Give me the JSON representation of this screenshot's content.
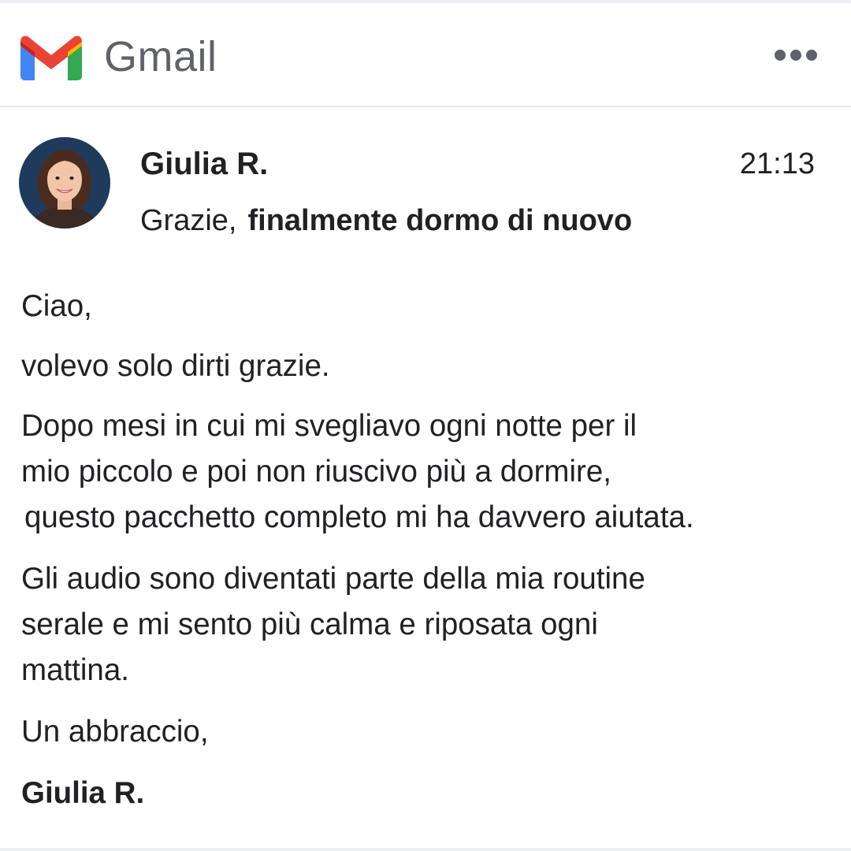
{
  "header": {
    "app_title": "Gmail",
    "logo_icon": "gmail-logo-icon",
    "more_icon": "more-horizontal-icon"
  },
  "message": {
    "sender_name": "Giulia R.",
    "time": "21:13",
    "subject_lead": "Grazie,",
    "subject_rest": "finalmente dormo di nuovo",
    "avatar_icon": "sender-avatar"
  },
  "body": {
    "greeting": "Ciao,",
    "thanks": "volevo solo dirti grazie.",
    "story_line1": "Dopo mesi in cui mi svegliavo ogni notte per il",
    "story_line2": "mio piccolo e poi non riuscivo più a dormire,",
    "story_line3": "questo pacchetto completo mi ha davvero aiutata.",
    "audio_line1": "Gli audio sono diventati parte della mia routine",
    "audio_line2": "serale e mi sento più calma e riposata ogni",
    "audio_line3": "mattina.",
    "closing": "Un abbraccio,",
    "signature": "Giulia R."
  },
  "colors": {
    "gmail_red": "#EA4335",
    "gmail_blue": "#4285F4",
    "gmail_green": "#34A853",
    "gmail_yellow": "#FBBC04",
    "title_grey": "#5f6368",
    "text": "#202124",
    "avatar_background": "#1f3b5c"
  }
}
